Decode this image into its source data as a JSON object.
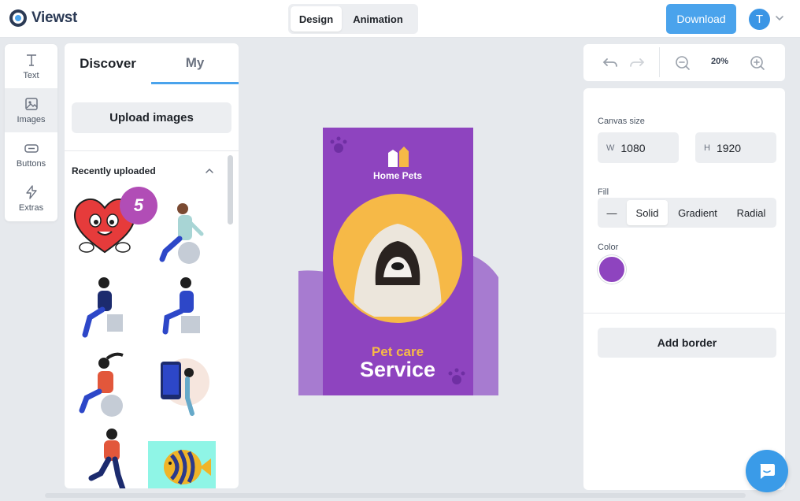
{
  "app": {
    "name": "Viewst"
  },
  "header": {
    "modes": [
      "Design",
      "Animation"
    ],
    "active_mode": "Design",
    "download_label": "Download",
    "avatar_initial": "T"
  },
  "tools": [
    {
      "label": "Text",
      "icon": "text-icon"
    },
    {
      "label": "Images",
      "icon": "image-icon",
      "active": true
    },
    {
      "label": "Buttons",
      "icon": "button-icon"
    },
    {
      "label": "Extras",
      "icon": "lightning-icon"
    }
  ],
  "images_panel": {
    "tabs": [
      "Discover",
      "My"
    ],
    "active_tab": "My",
    "upload_label": "Upload images",
    "section_title": "Recently uploaded",
    "badge_number": "5"
  },
  "canvas": {
    "brand": "Home Pets",
    "headline_small": "Pet care",
    "headline_large": "Service",
    "colors": {
      "background": "#8e44bf",
      "accent": "#f6b947",
      "shadow": "#a77bd0"
    }
  },
  "zoom": {
    "level": "20%"
  },
  "properties": {
    "canvas_size_label": "Canvas size",
    "width_prefix": "W",
    "width_value": "1080",
    "height_prefix": "H",
    "height_value": "1920",
    "fill_label": "Fill",
    "fill_options": [
      "—",
      "Solid",
      "Gradient",
      "Radial"
    ],
    "fill_active": "Solid",
    "color_label": "Color",
    "color_value": "#8e44bf",
    "add_border_label": "Add border"
  },
  "accent_color": "#4aa3ec"
}
